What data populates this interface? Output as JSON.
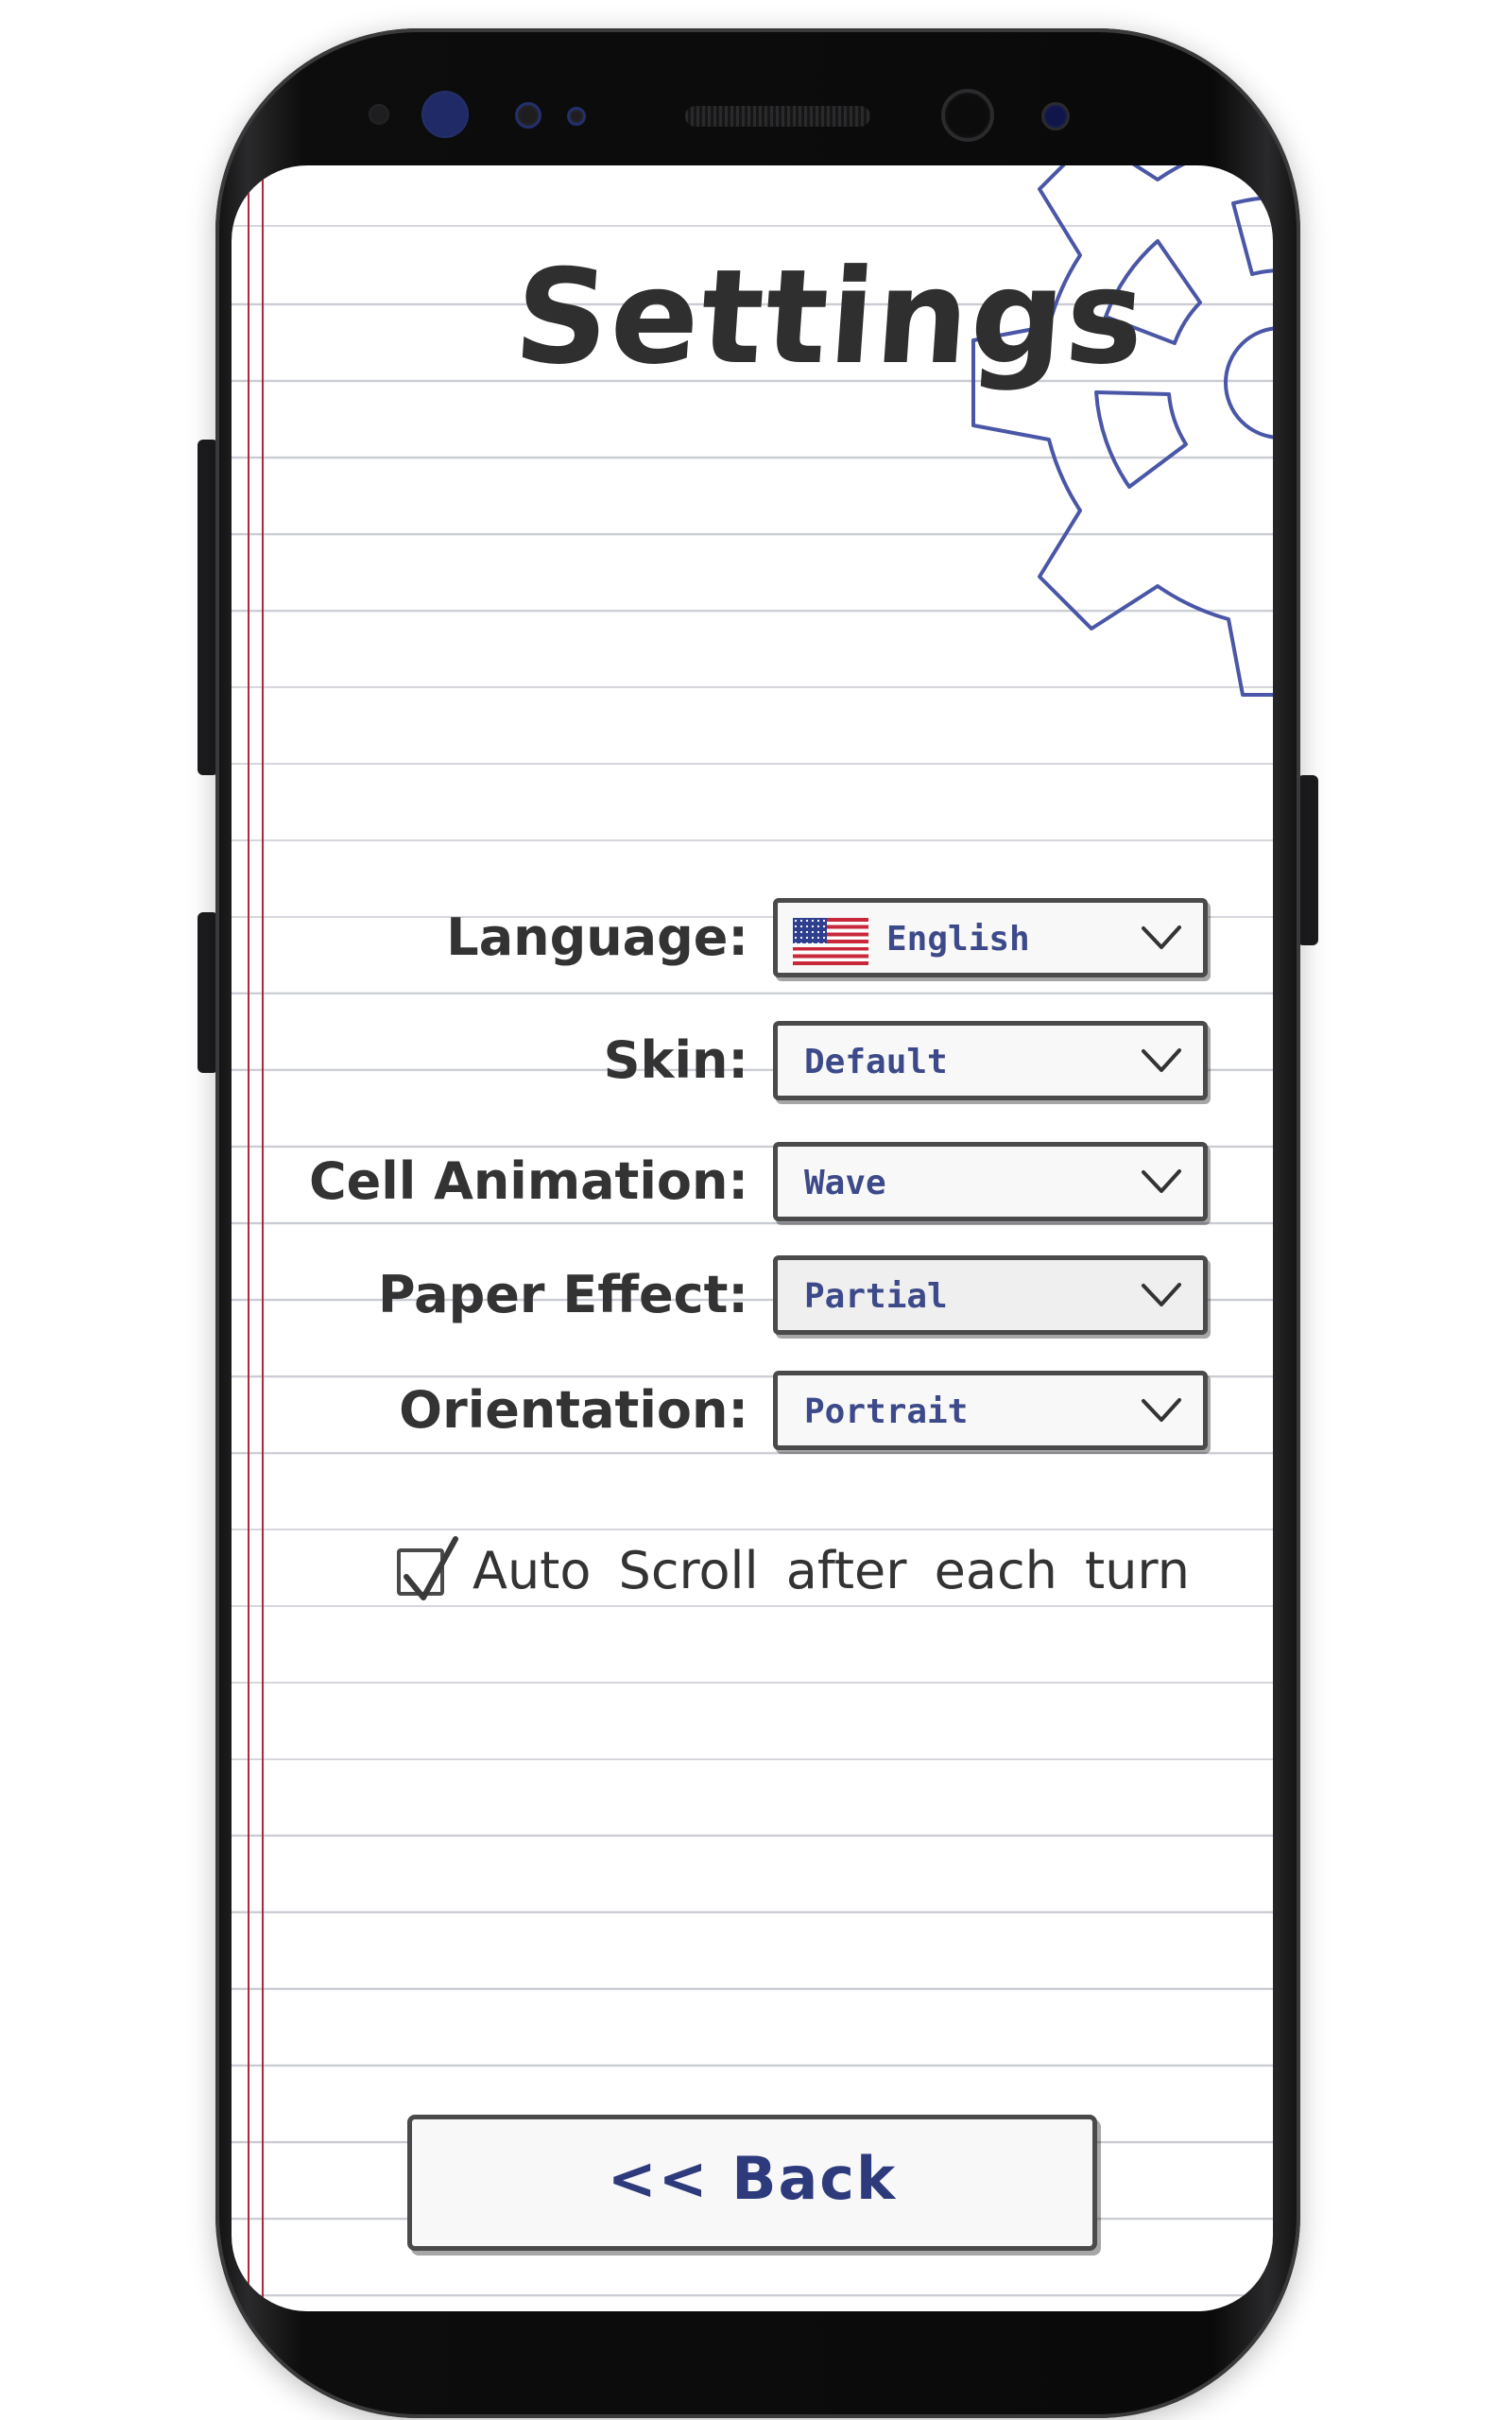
{
  "screen": {
    "title": "Settings"
  },
  "settings": [
    {
      "label": "Language:",
      "value": "English",
      "icon": "us-flag-icon"
    },
    {
      "label": "Skin:",
      "value": "Default",
      "icon": ""
    },
    {
      "label": "Cell Animation:",
      "value": "Wave",
      "icon": ""
    },
    {
      "label": "Paper Effect:",
      "value": "Partial",
      "icon": ""
    },
    {
      "label": "Orientation:",
      "value": "Portrait",
      "icon": ""
    }
  ],
  "auto_scroll": {
    "label": "Auto Scroll after each turn",
    "checked": true
  },
  "back_button": {
    "label": "<< Back"
  },
  "colors": {
    "ink_blue": "#3d4a8a",
    "gear_outline": "#4a56a6",
    "margin_red": "#b0283c",
    "rule_line": "#c9cbd3",
    "text_dark": "#333333"
  }
}
